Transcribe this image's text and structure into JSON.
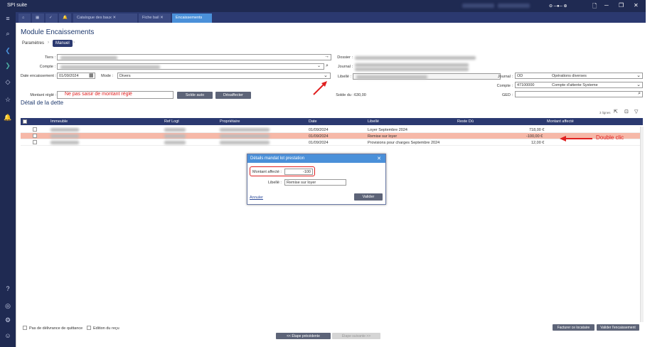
{
  "app": {
    "title": "SPI suite"
  },
  "tabs": [
    {
      "label": "Catalogue des baux"
    },
    {
      "label": "Fiche bail"
    },
    {
      "label": "Encaissements"
    }
  ],
  "page": {
    "title": "Module Encaissements"
  },
  "steps": [
    {
      "label": "Paramètres"
    },
    {
      "label": "Manuel"
    }
  ],
  "form": {
    "tiers_label": "Tiers :",
    "compte_label": "Compte :",
    "date_label": "Date encaissement :",
    "date_value": "01/09/2024",
    "mode_label": "Mode :",
    "mode_value": "Divers",
    "dossier_label": "Dossier :",
    "journal_label": "Journal :",
    "libelle_label": "Libellé :",
    "journal2_label": "Journal :",
    "journal2_code": "OD",
    "journal2_name": "Opérations diverses",
    "compte2_label": "Compte :",
    "compte2_code": "47100000",
    "compte2_name": "Compte d'attente Systeme",
    "ged_label": "GED :",
    "montant_label": "Montant réglé :",
    "montant_warning": "Ne pas saisir de montant réglé",
    "solde_auto": "Solde auto",
    "desaffecter": "Désaffecter",
    "solde_du_label": "Solde du :",
    "solde_du_value": "630,00"
  },
  "detail": {
    "title": "Détail de la dette",
    "count": "3 lignes"
  },
  "table": {
    "headers": [
      "Immeuble",
      "Ref Logt",
      "Propriétaire",
      "Date",
      "Libellé",
      "Reste Dû",
      "Montant affecté"
    ],
    "rows": [
      {
        "date": "01/09/2024",
        "libelle": "Loyer Septembre      2024",
        "montant": "718,00 €"
      },
      {
        "date": "01/09/2024",
        "libelle": "Remise sur loyer",
        "montant": "-100,00 €"
      },
      {
        "date": "01/09/2024",
        "libelle": "Provisions pour charges Septembre      2024",
        "montant": "12,00 €"
      }
    ]
  },
  "annotation": {
    "double_clic": "Double clic"
  },
  "dialog": {
    "title": "Détails mandat lot prestation",
    "montant_label": "Montant affecté :",
    "montant_value": "-100",
    "libelle_label": "Libellé :",
    "libelle_value": "Remise sur loyer",
    "annuler": "Annuler",
    "valider": "Valider"
  },
  "footer": {
    "check1": "Pas de délivrance de quittance",
    "check2": "Edition du reçu",
    "facturer": "Facturer ce locataire",
    "valider_enc": "Valider l'encaissement",
    "prev": "<< Étape précédente",
    "next": "Étape suivante >>"
  },
  "colors": {
    "navy": "#1f2a52",
    "accent": "#4a90d9",
    "warning": "#e02020",
    "selected_row": "#f6b8a8"
  }
}
